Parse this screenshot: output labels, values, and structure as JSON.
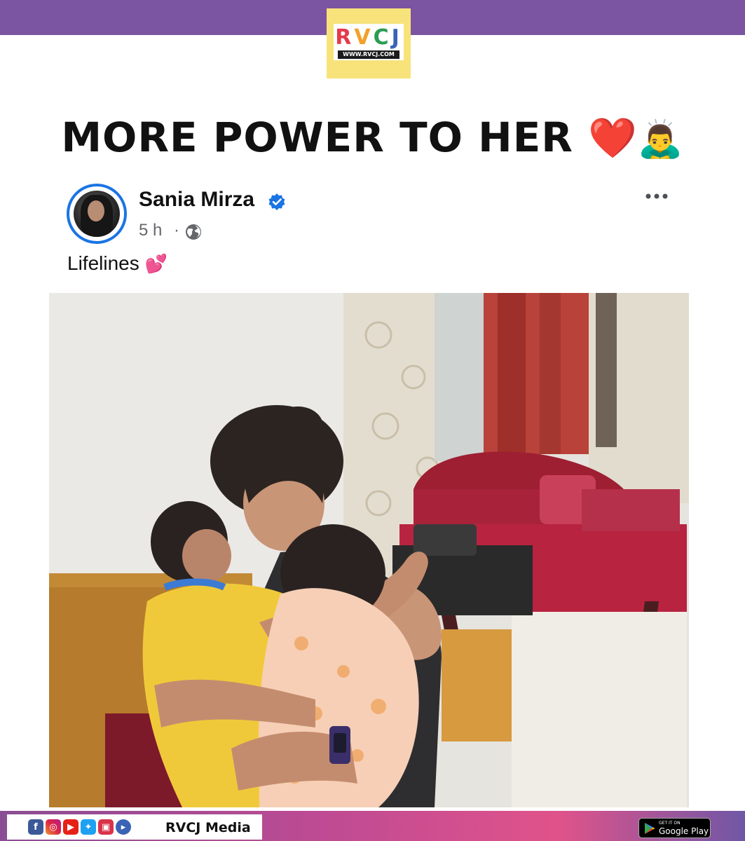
{
  "logo": {
    "letters": [
      "R",
      "V",
      "C",
      "J"
    ],
    "url": "WWW.RVCJ.COM"
  },
  "headline": {
    "text": "MORE POWER TO HER",
    "heart": "❤️",
    "bow": "🙇‍♂️"
  },
  "post": {
    "poster_name": "Sania Mirza",
    "time": "5 h",
    "separator": "·",
    "caption": "Lifelines",
    "caption_emoji": "💕"
  },
  "footer": {
    "brand": "RVCJ Media",
    "social_icons": [
      "facebook-icon",
      "instagram-icon",
      "youtube-icon",
      "twitter-icon",
      "youtube-studio-icon",
      "play-icon"
    ],
    "store_badge": {
      "get": "GET IT ON",
      "name": "Google Play"
    }
  },
  "colors": {
    "top_bar": "#7b55a2",
    "logo_bg": "#f7e37a",
    "verified": "#1b74e4",
    "muted_text": "#65676b",
    "headline_text": "#111111"
  }
}
